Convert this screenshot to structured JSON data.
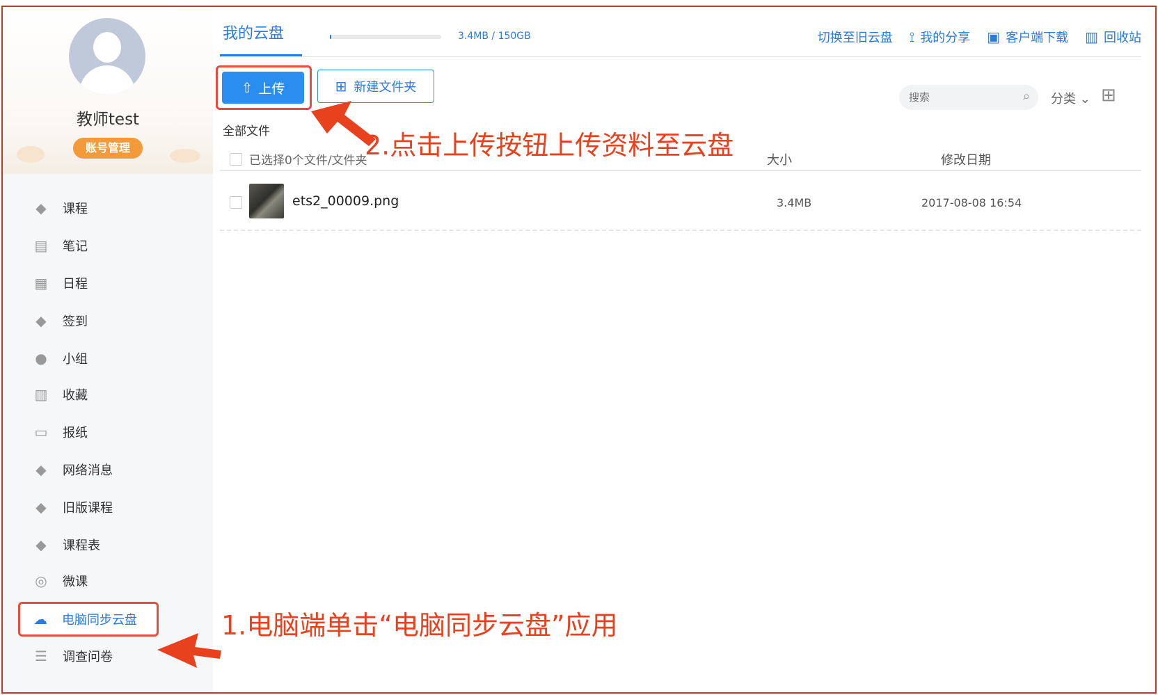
{
  "profile": {
    "username": "教师test",
    "account_button": "账号管理"
  },
  "sidebar": {
    "items": [
      {
        "label": "课程",
        "icon": "course-icon"
      },
      {
        "label": "笔记",
        "icon": "note-icon"
      },
      {
        "label": "日程",
        "icon": "calendar-icon"
      },
      {
        "label": "签到",
        "icon": "checkin-icon"
      },
      {
        "label": "小组",
        "icon": "group-icon"
      },
      {
        "label": "收藏",
        "icon": "bookmark-icon"
      },
      {
        "label": "报纸",
        "icon": "newspaper-icon"
      },
      {
        "label": "网络消息",
        "icon": "news-icon"
      },
      {
        "label": "旧版课程",
        "icon": "old-course-icon"
      },
      {
        "label": "课程表",
        "icon": "timetable-icon"
      },
      {
        "label": "微课",
        "icon": "eye-icon"
      },
      {
        "label": "电脑同步云盘",
        "icon": "cloud-icon",
        "active": true
      },
      {
        "label": "调查问卷",
        "icon": "survey-icon"
      }
    ]
  },
  "header": {
    "tab": "我的云盘",
    "storage_text": "3.4MB / 150GB",
    "storage_used_fraction": 2.21e-05,
    "links": {
      "switch_old": "切换至旧云盘",
      "my_share": "我的分享",
      "client_download": "客户端下载",
      "recycle": "回收站"
    }
  },
  "toolbar": {
    "upload_label": "上传",
    "new_folder_label": "新建文件夹",
    "search_placeholder": "搜索",
    "sort_label": "分类"
  },
  "breadcrumb": "全部文件",
  "table": {
    "select_text": "已选择0个文件/文件夹",
    "col_size": "大小",
    "col_date": "修改日期",
    "rows": [
      {
        "name": "ets2_00009.png",
        "size": "3.4MB",
        "date": "2017-08-08 16:54"
      }
    ]
  },
  "annotations": {
    "step1": "1.电脑端单击“电脑同步云盘”应用",
    "step2": "2.点击上传按钮上传资料至云盘"
  },
  "colors": {
    "accent": "#2a7ae2",
    "annotation": "#e8411e",
    "account_button": "#f39a3a"
  }
}
